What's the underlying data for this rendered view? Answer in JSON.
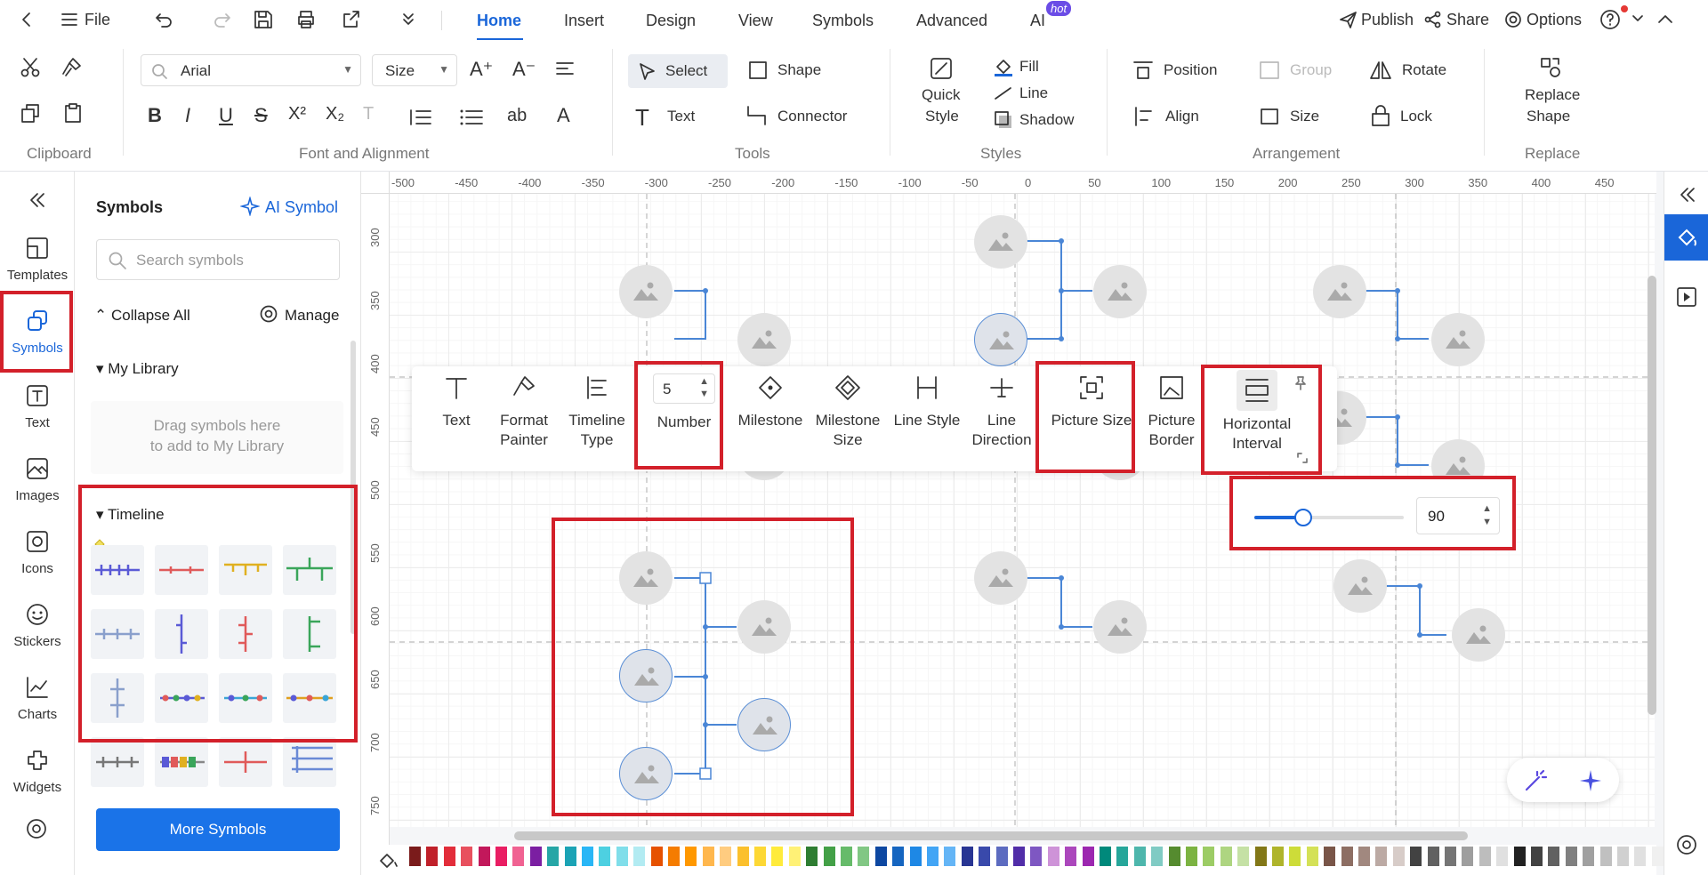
{
  "topbar": {
    "file": "File",
    "tabs": [
      "Home",
      "Insert",
      "Design",
      "View",
      "Symbols",
      "Advanced",
      "AI"
    ],
    "hot": "hot",
    "publish": "Publish",
    "share": "Share",
    "options": "Options"
  },
  "ribbon": {
    "font": "Arial",
    "size": "Size",
    "select": "Select",
    "shape": "Shape",
    "text": "Text",
    "connector": "Connector",
    "quick_style": [
      "Quick",
      "Style"
    ],
    "fill": "Fill",
    "line": "Line",
    "shadow": "Shadow",
    "position": "Position",
    "group": "Group",
    "rotate": "Rotate",
    "align": "Align",
    "lock": "Lock",
    "replace_shape": [
      "Replace",
      "Shape"
    ],
    "groups": {
      "clipboard": "Clipboard",
      "font": "Font and Alignment",
      "tools": "Tools",
      "styles": "Styles",
      "arrangement": "Arrangement",
      "replace": "Replace"
    }
  },
  "leftnav": [
    "Templates",
    "Symbols",
    "Text",
    "Images",
    "Icons",
    "Stickers",
    "Charts",
    "Widgets"
  ],
  "panel": {
    "title": "Symbols",
    "ai_symbol": "AI Symbol",
    "search_placeholder": "Search symbols",
    "collapse_all": "Collapse All",
    "manage": "Manage",
    "my_library": "My Library",
    "drag_hint": [
      "Drag symbols here",
      "to add to My Library"
    ],
    "timeline": "Timeline",
    "more_symbols": "More Symbols"
  },
  "ruler": {
    "top": [
      "-500",
      "-450",
      "-400",
      "-350",
      "-300",
      "-250",
      "-200",
      "-150",
      "-100",
      "-50",
      "0",
      "50",
      "100",
      "150",
      "200",
      "250",
      "300",
      "350",
      "400",
      "450"
    ],
    "left": [
      "300",
      "350",
      "400",
      "450",
      "500",
      "550",
      "600",
      "650",
      "700",
      "750"
    ]
  },
  "context": {
    "number_value": "5",
    "items": [
      [
        "Text"
      ],
      [
        "Format",
        "Painter"
      ],
      [
        "Timeline",
        "Type"
      ],
      [
        "Number"
      ],
      [
        "Milestone"
      ],
      [
        "Milestone",
        "Size"
      ],
      [
        "Line Style"
      ],
      [
        "Line",
        "Direction"
      ],
      [
        "Picture Size"
      ],
      [
        "Picture",
        "Border"
      ],
      [
        "Horizontal",
        "Interval"
      ]
    ]
  },
  "interval": {
    "value": "90",
    "slider_fraction": 0.33
  },
  "colors": [
    "#7a1b1b",
    "#c0202a",
    "#e22d3a",
    "#e8505e",
    "#c2185b",
    "#e91e63",
    "#f06292",
    "#7b1fa2",
    "#26a6a6",
    "#1ba3b5",
    "#29b6f6",
    "#4dd0e1",
    "#80deea",
    "#b2ebf2",
    "#e65100",
    "#f57c00",
    "#ff9800",
    "#ffb74d",
    "#ffcc80",
    "#fbc02d",
    "#fdd835",
    "#ffeb3b",
    "#fff176",
    "#2e7d32",
    "#43a047",
    "#66bb6a",
    "#81c784",
    "#0d47a1",
    "#1565c0",
    "#1e88e5",
    "#42a5f5",
    "#64b5f6",
    "#283593",
    "#3949ab",
    "#5c6bc0",
    "#512da8",
    "#7e57c2",
    "#ce93d8",
    "#ab47bc",
    "#9c27b0",
    "#00897b",
    "#26a69a",
    "#4db6ac",
    "#80cbc4",
    "#558b2f",
    "#7cb342",
    "#9ccc65",
    "#aed581",
    "#c5e1a5",
    "#827717",
    "#afb42b",
    "#cddc39",
    "#d4e157",
    "#795548",
    "#8d6e63",
    "#a1887f",
    "#bcaaa4",
    "#d7ccc8",
    "#424242",
    "#616161",
    "#757575",
    "#9e9e9e",
    "#bdbdbd",
    "#e0e0e0",
    "#212121",
    "#424242",
    "#616161",
    "#808080",
    "#a0a0a0",
    "#c0c0c0",
    "#d0d0d0",
    "#e0e0e0",
    "#f0f0f0",
    "#ffffff"
  ]
}
